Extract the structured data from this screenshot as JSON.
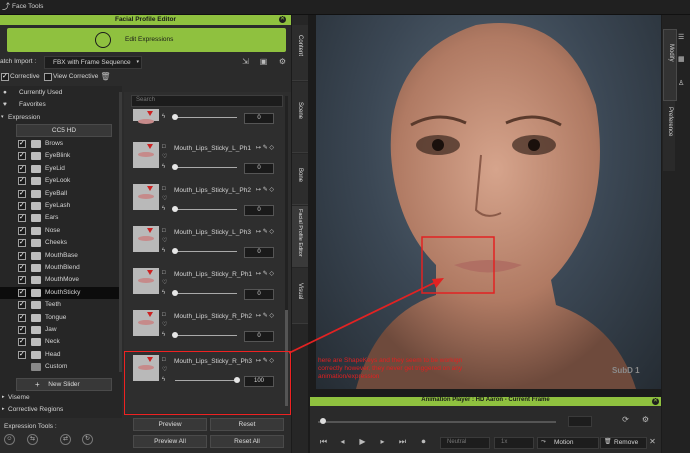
{
  "window": {
    "title": "Face Tools"
  },
  "panel": {
    "title": "Facial Profile Editor",
    "edit_button": "Edit Expressions",
    "batch_label": "atch Import :",
    "batch_value": "FBX with Frame Sequence",
    "corrective_label": "Corrective",
    "view_corrective_label": "View Corrective"
  },
  "tree": {
    "top_items": [
      "Currently Used",
      "Favorites"
    ],
    "expression_label": "Expression",
    "preset": "CC5 HD",
    "items": [
      "Brows",
      "EyeBlink",
      "EyeLid",
      "EyeLook",
      "EyeBall",
      "EyeLash",
      "Ears",
      "Nose",
      "Cheeks",
      "MouthBase",
      "MouthBlend",
      "MouthMove",
      "MouthSticky",
      "Teeth",
      "Tongue",
      "Jaw",
      "Neck",
      "Head",
      "Custom"
    ],
    "selected": "MouthSticky",
    "new_slider": "New Slider",
    "viseme": "Viseme",
    "corrective_regions": "Corrective Regions",
    "expression_tools": "Expression Tools :"
  },
  "sliders": {
    "search_placeholder": "Search",
    "rows": [
      {
        "name": "",
        "value": "0"
      },
      {
        "name": "Mouth_Lips_Sticky_L_Ph1",
        "value": "0"
      },
      {
        "name": "Mouth_Lips_Sticky_L_Ph2",
        "value": "0"
      },
      {
        "name": "Mouth_Lips_Sticky_L_Ph3",
        "value": "0"
      },
      {
        "name": "Mouth_Lips_Sticky_R_Ph1",
        "value": "0"
      },
      {
        "name": "Mouth_Lips_Sticky_R_Ph2",
        "value": "0"
      },
      {
        "name": "Mouth_Lips_Sticky_R_Ph3",
        "value": "100"
      }
    ],
    "preview": "Preview",
    "reset": "Reset",
    "preview_all": "Preview All",
    "reset_all": "Reset All"
  },
  "vtabs": [
    "Content",
    "Scene",
    "Bone",
    "Facial Profile Editor",
    "Visual"
  ],
  "right_tabs": [
    "Modify",
    "Preference"
  ],
  "viewport": {
    "badge": "SubD 1",
    "annotation": "here are ShapeKeys and they seem to be workign correctly however, they never get triggered on any animation/expression"
  },
  "anim": {
    "title": "Animation Player : HD Aaron - Current Frame",
    "motion_label": "Motion",
    "remove_label": "Remove",
    "speed_label": "Neutral",
    "rate": "1x"
  },
  "colors": {
    "accent": "#8fc13f",
    "annotation": "#e22222"
  }
}
